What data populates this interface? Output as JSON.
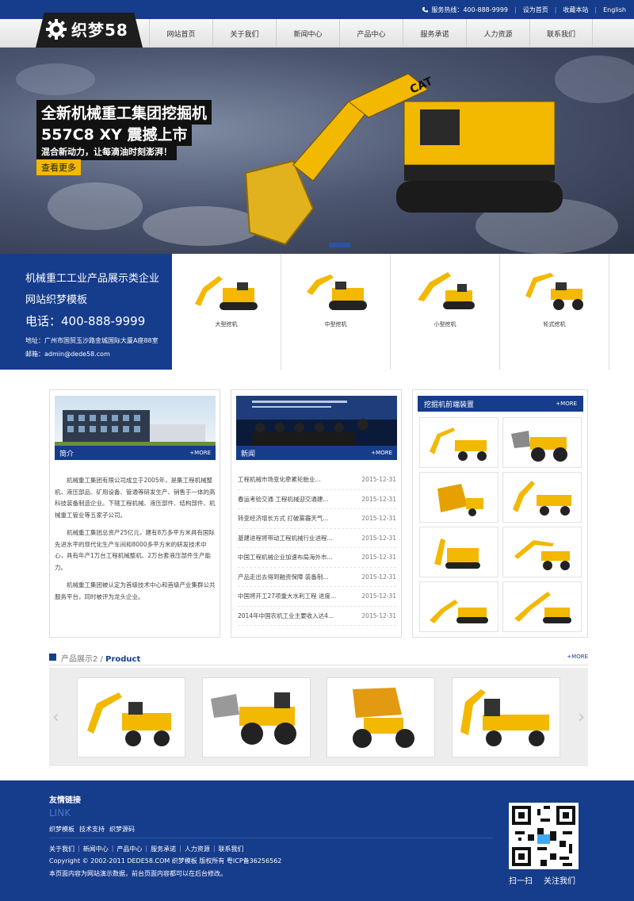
{
  "topbar": {
    "hotline": "服务热线：400-888-9999",
    "set_home": "设为首页",
    "bookmark": "收藏本站",
    "english": "English"
  },
  "logo": {
    "text": "织梦58"
  },
  "nav": [
    "网站首页",
    "关于我们",
    "新闻中心",
    "产品中心",
    "服务承诺",
    "人力资源",
    "联系我们"
  ],
  "banner": {
    "line1": "全新机械重工集团挖掘机",
    "line2": "557C8 XY 震撼上市",
    "line3": "混合新动力，让每滴油时刻澎湃！",
    "button": "查看更多",
    "brand": "CAT"
  },
  "info": {
    "line1": "机械重工工业产品展示类企业",
    "line2": "网站织梦模板",
    "phone": "电话：400-888-9999",
    "address": "地址：广州市国贸玉沙路金城国际大厦A座88室",
    "email": "邮箱：admin@dede58.com"
  },
  "categories": [
    "大型挖机",
    "中型挖机",
    "小型挖机",
    "轮式挖机"
  ],
  "intro": {
    "title": "简介",
    "more": "+MORE",
    "paragraphs": [
      "机械重工集团有限公司成立于2005年，是集工程机械整机、液压部品、矿用设备、管通等研发生产、销售于一体的高科技装备制造企业。下辖工程机械、液压部件、结构部件、机械重工管业等五家子公司。",
      "机械重工集团总资产25亿元，建有8万多平方米具有国际先进水平的现代化生产车间和8000多平方米的研发技术中心，具有年产1万台工程机械整机、2万台套液压部件生产能力。",
      "机械重工集团被认定为首级技术中心和首级产业集群公共服务平台，同时被评为龙头企业。"
    ]
  },
  "news": {
    "title": "新闻",
    "more": "+MORE",
    "items": [
      {
        "title": "工程机械市场变化牵累轮胎业...",
        "date": "2015-12-31"
      },
      {
        "title": "春运考验交通 工程机械迎交通建...",
        "date": "2015-12-31"
      },
      {
        "title": "转变经济增长方式 打破雾霾天气...",
        "date": "2015-12-31"
      },
      {
        "title": "基建进程将带动工程机械行业进程...",
        "date": "2015-12-31"
      },
      {
        "title": "中国工程机械企业加速布局海外市...",
        "date": "2015-12-31"
      },
      {
        "title": "产品走出去得到融资保障 装备制...",
        "date": "2015-12-31"
      },
      {
        "title": "中国将开工27项重大水利工程 进度...",
        "date": "2015-12-31"
      },
      {
        "title": "2014年中国农机工业主要收入达4...",
        "date": "2015-12-31"
      }
    ]
  },
  "front": {
    "title": "挖掘机前端装置",
    "more": "+MORE"
  },
  "products2": {
    "label": "产品展示2 /",
    "label_en": "Product",
    "more": "+MORE"
  },
  "footer": {
    "links_title": "友情链接",
    "links_en": "LINK",
    "links": [
      "织梦模板",
      "技术支持",
      "织梦源码"
    ],
    "nav": [
      "关于我们",
      "新闻中心",
      "产品中心",
      "服务承诺",
      "人力资源",
      "联系我们"
    ],
    "copyright": "Copyright © 2002-2011 DEDE58.COM 织梦模板 版权所有 粤ICP备36256562",
    "note": "本页面内容为网站演示数据，前台页面内容都可以在后台修改。",
    "scan": "扫一扫",
    "follow": "关注我们"
  },
  "colors": {
    "primary": "#163c8c",
    "accent": "#f3b800"
  }
}
